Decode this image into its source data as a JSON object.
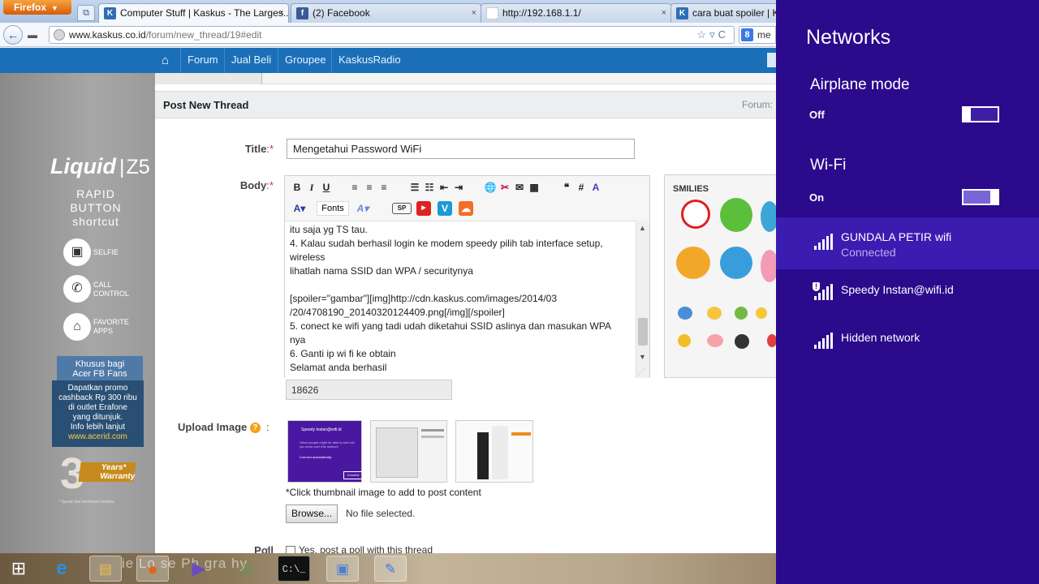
{
  "browser": {
    "firefox_label": "Firefox",
    "tabs": [
      {
        "label": "Computer Stuff | Kaskus - The Larges...",
        "favicon": "kaskus-icon",
        "color": "#2f6db4"
      },
      {
        "label": "(2) Facebook",
        "favicon": "facebook-icon",
        "color": "#3b5998"
      },
      {
        "label": "http://192.168.1.1/",
        "favicon": "page-icon",
        "color": "#999999"
      },
      {
        "label": "cara buat spoiler | Kas",
        "favicon": "kaskus-icon",
        "color": "#2f6db4"
      }
    ],
    "tab_close": "×",
    "url_domain": "www.kaskus.co.id",
    "url_path": "/forum/new_thread/19#edit",
    "search_text": "me"
  },
  "site": {
    "nav": [
      "Forum",
      "Jual Beli",
      "Groupee",
      "KaskusRadio"
    ],
    "brand_color": "#1a6fb8"
  },
  "ad": {
    "brand": "Liquid",
    "model": "Z5",
    "tagline": [
      "RAPID",
      "BUTTON",
      "shortcut"
    ],
    "features": [
      {
        "label": [
          "SELFIE"
        ],
        "icon": "camera-icon"
      },
      {
        "label": [
          "CALL",
          "CONTROL"
        ],
        "icon": "phone-icon"
      },
      {
        "label": [
          "FAVORITE",
          "APPS"
        ],
        "icon": "house-icon"
      }
    ],
    "khusus": [
      "Khusus bagi",
      "Acer FB Fans"
    ],
    "promo": [
      "Dapatkan promo",
      "cashback Rp 300 ribu",
      "di outlet Erafone",
      "yang ditunjuk.",
      "Info lebih lanjut"
    ],
    "promo_link": "www.acerid.com",
    "warranty_number": "3",
    "warranty_text": [
      "Years*",
      "Warranty"
    ],
    "terms": "* Syarat dan ketentuan berlaku"
  },
  "form": {
    "header": "Post New Thread",
    "forum_label": "Forum:",
    "title_label": "Title",
    "body_label": "Body",
    "required": "*",
    "colon": ":",
    "title_value": "Mengetahui Password WiFi",
    "fonts_label": "Fonts",
    "body_lines": [
      "itu saja yg TS tau.",
      "4. Kalau sudah berhasil login ke modem speedy pilih tab interface setup,",
      "wireless",
      "lihatlah nama SSID dan WPA / securitynya",
      "",
      "[spoiler=\"gambar\"][img]http://cdn.kaskus.com/images/2014/03",
      "/20/4708190_20140320124409.png[/img][/spoiler]",
      "5. conect ke wifi yang tadi udah diketahui SSID aslinya dan masukan WPA",
      "nya",
      "6. Ganti ip wi fi ke obtain",
      "Selamat anda berhasil"
    ],
    "char_count": "18626",
    "smilies_label": "SMILIES",
    "upload_label": "Upload Image",
    "upload_caption": "*Click thumbnail image to add to post content",
    "browse_label": "Browse...",
    "no_file": "No file selected.",
    "poll_label": "Poll",
    "poll_option": "Yes, post a poll with this thread",
    "thumb1": {
      "title": "Speedy Instan@wifi.id",
      "text": "Other people might be able to see info you send over this network",
      "option": "Connect automatically",
      "button": "Connect"
    }
  },
  "taskbar": {
    "items": [
      "windows-start-icon",
      "internet-explorer-icon",
      "file-explorer-icon",
      "firefox-icon",
      "media-player-icon",
      "messenger-icon",
      "command-prompt-icon",
      "remote-desktop-icon",
      "paint-icon"
    ],
    "wallpaper_text": "ie Lo  se Ph   gra hy"
  },
  "networks": {
    "title": "Networks",
    "airplane_label": "Airplane mode",
    "airplane_state": "Off",
    "wifi_label": "Wi-Fi",
    "wifi_state": "On",
    "list": [
      {
        "name": "GUNDALA PETIR wifi",
        "status": "Connected",
        "secured": false,
        "selected": true
      },
      {
        "name": "Speedy Instan@wifi.id",
        "status": "",
        "secured": true,
        "selected": false
      },
      {
        "name": "Hidden network",
        "status": "",
        "secured": false,
        "selected": false
      }
    ],
    "bg_color": "#2b0a8c"
  }
}
